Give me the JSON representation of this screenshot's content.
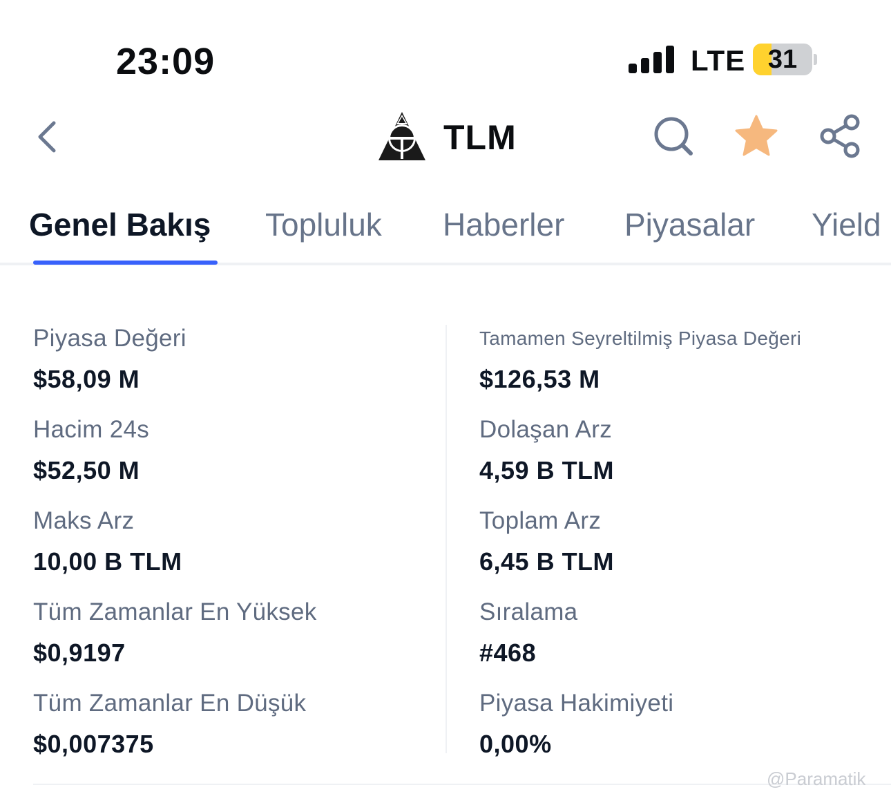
{
  "status_bar": {
    "time": "23:09",
    "network": "LTE",
    "battery": "31"
  },
  "header": {
    "title": "TLM"
  },
  "tabs": [
    {
      "label": "Genel Bakış"
    },
    {
      "label": "Topluluk"
    },
    {
      "label": "Haberler"
    },
    {
      "label": "Piyasalar"
    },
    {
      "label": "Yield"
    }
  ],
  "stats_left": [
    {
      "label": "Piyasa Değeri",
      "value": "$58,09 M"
    },
    {
      "label": "Hacim 24s",
      "value": "$52,50 M"
    },
    {
      "label": "Maks Arz",
      "value": "10,00 B TLM"
    },
    {
      "label": "Tüm Zamanlar En Yüksek",
      "value": "$0,9197"
    },
    {
      "label": "Tüm Zamanlar En Düşük",
      "value": "$0,007375"
    }
  ],
  "stats_right": [
    {
      "label": "Tamamen Seyreltilmiş Piyasa Değeri",
      "value": "$126,53 M"
    },
    {
      "label": "Dolaşan Arz",
      "value": "4,59 B TLM"
    },
    {
      "label": "Toplam Arz",
      "value": "6,45 B TLM"
    },
    {
      "label": "Sıralama",
      "value": "#468"
    },
    {
      "label": "Piyasa Hakimiyeti",
      "value": "0,00%"
    }
  ],
  "watermark": "@Paramatik",
  "colors": {
    "accent": "#3861fb",
    "star": "#f6b87e",
    "muted_text": "#67748a"
  }
}
